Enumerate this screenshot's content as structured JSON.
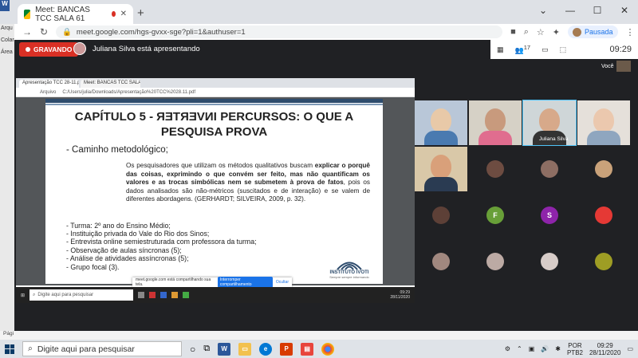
{
  "browser": {
    "tab_title": "Meet: BANCAS TCC SALA 61",
    "url": "meet.google.com/hgs-gvxx-sge?pli=1&authuser=1",
    "profile_label": "Pausada"
  },
  "meet": {
    "recording_label": "GRAVANDO",
    "presenter_text": "Juliana Silva está apresentando",
    "participant_count": "17",
    "time": "09:29",
    "self_label": "Você"
  },
  "shared": {
    "tabs": [
      "Apresentação TCC 28-11.pdf",
      "Meet: BANCAS TCC SALA 61"
    ],
    "addr_prefix": "Arquivo",
    "addr_path": "C:/Users/julia/Downloads/Apresentação%20TCC%2028.11.pdf",
    "title_part1": "CAPÍTULO 5 - ",
    "title_flipped": "INVERTER",
    "title_part2": " PERCURSOS: O QUE A",
    "title_line2": "PESQUISA PROVA",
    "bullet_heading": "Caminho metodológico;",
    "quote_a": "Os pesquisadores que utilizam os métodos qualitativos buscam ",
    "quote_bold": "explicar o porquê das coisas, exprimindo o que convém ser feito, mas não quantificam os valores e as trocas simbólicas nem se submetem à prova de fatos",
    "quote_b": ", pois os dados analisados são não-métricos (suscitados e de interação) e se valem de diferentes abordagens. (GERHARDT; SILVEIRA, 2009, p. 32).",
    "bullets": [
      "Turma: 2º ano do Ensino Médio;",
      "Instituição privada do Vale do Rio dos Sinos;",
      "Entrevista online semiestruturada com professora da turma;",
      "Observação de aulas síncronas (5);",
      "Análise de atividades assíncronas (5);",
      "Grupo focal (3)."
    ],
    "logo_text": "INSTITUTO IVOTI",
    "logo_sub": "Sempre sempre informando",
    "sharebar_text": "meet.google.com está compartilhando sua tela.",
    "stop_label": "Interromper compartilhamento",
    "hide_label": "Ocultar",
    "search_placeholder": "Digite aqui para pesquisar",
    "clock": "09:29",
    "date": "28/11/2020"
  },
  "participants": {
    "presenter_name": "Juliana Silva",
    "initials": [
      "F",
      "S"
    ]
  },
  "left_strip": [
    "Arqu",
    "Colar",
    "Área"
  ],
  "status_left": "Pági",
  "taskbar": {
    "search_placeholder": "Digite aqui para pesquisar",
    "lang": "POR",
    "layout": "PTB2",
    "time": "09:29",
    "date": "28/11/2020"
  },
  "colors": {
    "recording": "#d93025",
    "accent": "#1a73e8",
    "slide_bar": "#2e4c6d"
  }
}
